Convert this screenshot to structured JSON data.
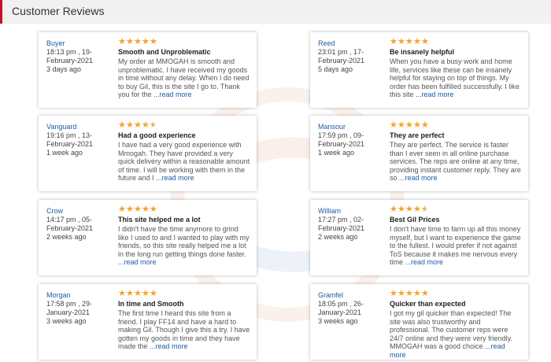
{
  "header": {
    "title": "Customer Reviews"
  },
  "more_label": "...read more",
  "reviews": [
    {
      "name": "Buyer",
      "time": "18:13 pm , 19-",
      "date": "February-2021",
      "ago": "3 days ago",
      "rating": 5,
      "title": "Smooth and Unproblematic",
      "text": "My order at MMOGAH is smooth and unproblematic. I have received my goods in time without any delay. When I do need to buy Gil, this is the site I go to. Thank you for the"
    },
    {
      "name": "Reed",
      "time": "23:01 pm , 17-",
      "date": "February-2021",
      "ago": "5 days ago",
      "rating": 5,
      "title": "Be insanely helpful",
      "text": "When you have a busy work and home life, services like these can be insanely helpful for staying on top of things. My order has been fulfilled successfully. I like this site"
    },
    {
      "name": "Vanguard",
      "time": "19:16 pm , 13-",
      "date": "February-2021",
      "ago": "1 week ago",
      "rating": 4.5,
      "title": "Had a good experience",
      "text": "I have had a very good experience with Mmogah. They have provided a very quick delivery within a reasonable amount of time. I will be working with them in the future and I"
    },
    {
      "name": "Mansour",
      "time": "17:59 pm , 09-",
      "date": "February-2021",
      "ago": "1 week ago",
      "rating": 5,
      "title": "They are perfect",
      "text": "They are perfect. The service is faster than I ever seen in all online purchase services. The reps are online at any time, providing instant customer reply. They are so"
    },
    {
      "name": "Crow",
      "time": "14:17 pm , 05-",
      "date": "February-2021",
      "ago": "2 weeks ago",
      "rating": 5,
      "title": "This site helped me a lot",
      "text": "I didn't have the time anymore to grind like I used to and I wanted to play with my friends, so this site really helped me a lot in the long run getting things done faster."
    },
    {
      "name": "William",
      "time": "17:27 pm , 02-",
      "date": "February-2021",
      "ago": "2 weeks ago",
      "rating": 4.5,
      "title": "Best Gil Prices",
      "text": "I don't have time to farm up all this money myself, but I want to experience the game to the fullest. I would prefer if not against ToS because it makes me nervous every time"
    },
    {
      "name": "Morgan",
      "time": "17:58 pm , 29-",
      "date": "January-2021",
      "ago": "3 weeks ago",
      "rating": 5,
      "title": "In time and Smooth",
      "text": "The first time I heard this site from a friend. I play FF14 and have a hard to making Gil. Though I give this a try. I have gotten my goods in time and they have made the"
    },
    {
      "name": "Gramfel",
      "time": "18:05 pm , 26-",
      "date": "January-2021",
      "ago": "3 weeks ago",
      "rating": 5,
      "title": "Quicker than expected",
      "text": "I got my gil quicker than expected! The site was also trustworthy and professional. The customer reps were 24/7 online and they were very friendly. MMOGAH was a good choice"
    }
  ]
}
